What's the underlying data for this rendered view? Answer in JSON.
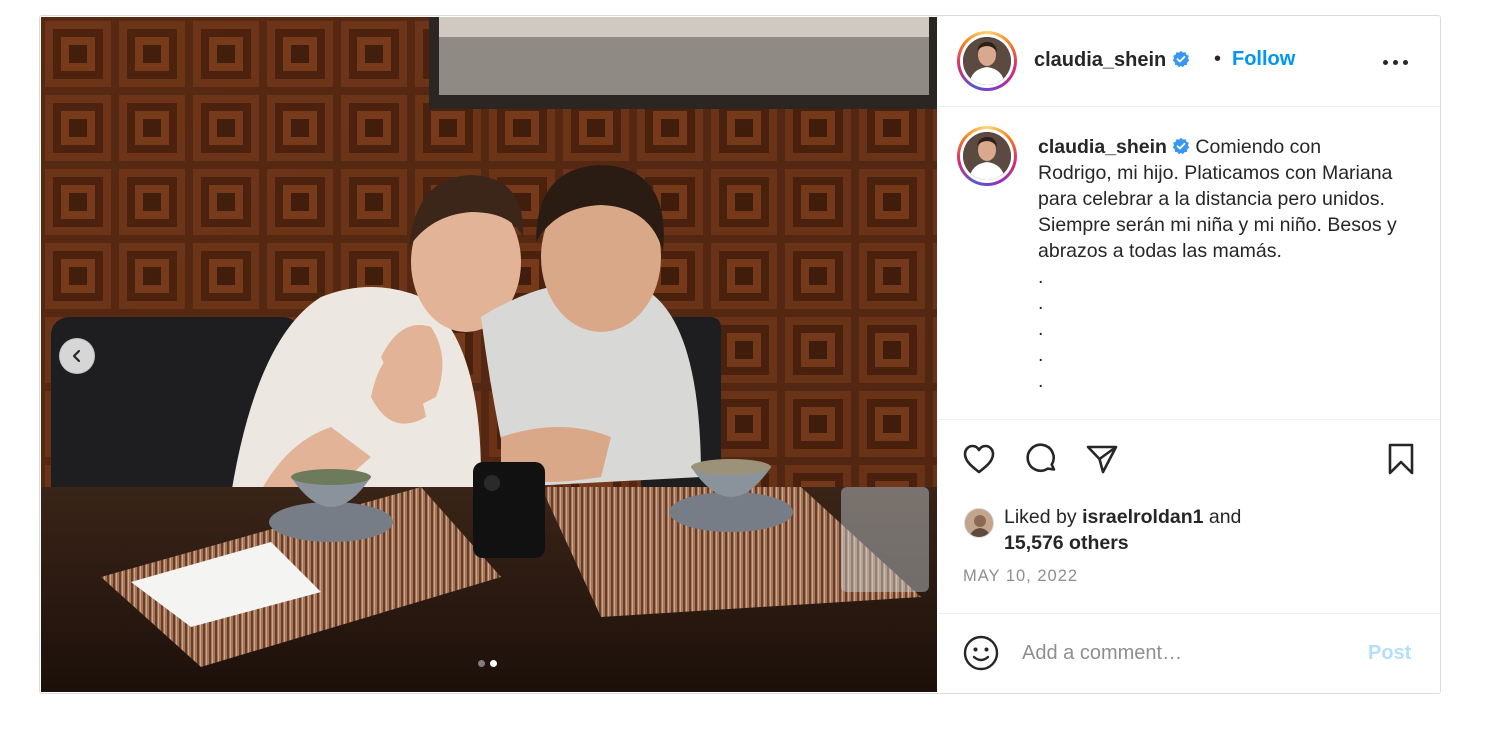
{
  "post": {
    "username": "claudia_shein",
    "separator": "•",
    "follow_label": "Follow",
    "caption_username": "claudia_shein",
    "caption": " Comiendo con Rodrigo, mi hijo. Platicamos con Mariana para celebrar a la distancia pero unidos. Siempre serán mi niña y mi niño. Besos y abrazos a todas las mamás.\n.\n.\n.\n.\n.",
    "liked_by_prefix": "Liked by ",
    "liked_by_user": "israelroldan1",
    "liked_by_suffix": " and",
    "others": "15,576 others",
    "date": "MAY 10, 2022",
    "comment_placeholder": "Add a comment…",
    "post_label": "Post",
    "carousel": {
      "slide_count": 2,
      "active_slide": 2
    }
  },
  "icons": {
    "verified": "verified-badge-icon",
    "more": "more-options-icon",
    "like": "heart-icon",
    "comment": "comment-icon",
    "share": "share-icon",
    "save": "bookmark-icon",
    "emoji": "emoji-icon",
    "prev": "chevron-left-icon"
  },
  "colors": {
    "link": "#0095f6",
    "post_disabled": "#b2dffc",
    "secondary_text": "#8e8e8e",
    "verified": "#3897f0"
  }
}
